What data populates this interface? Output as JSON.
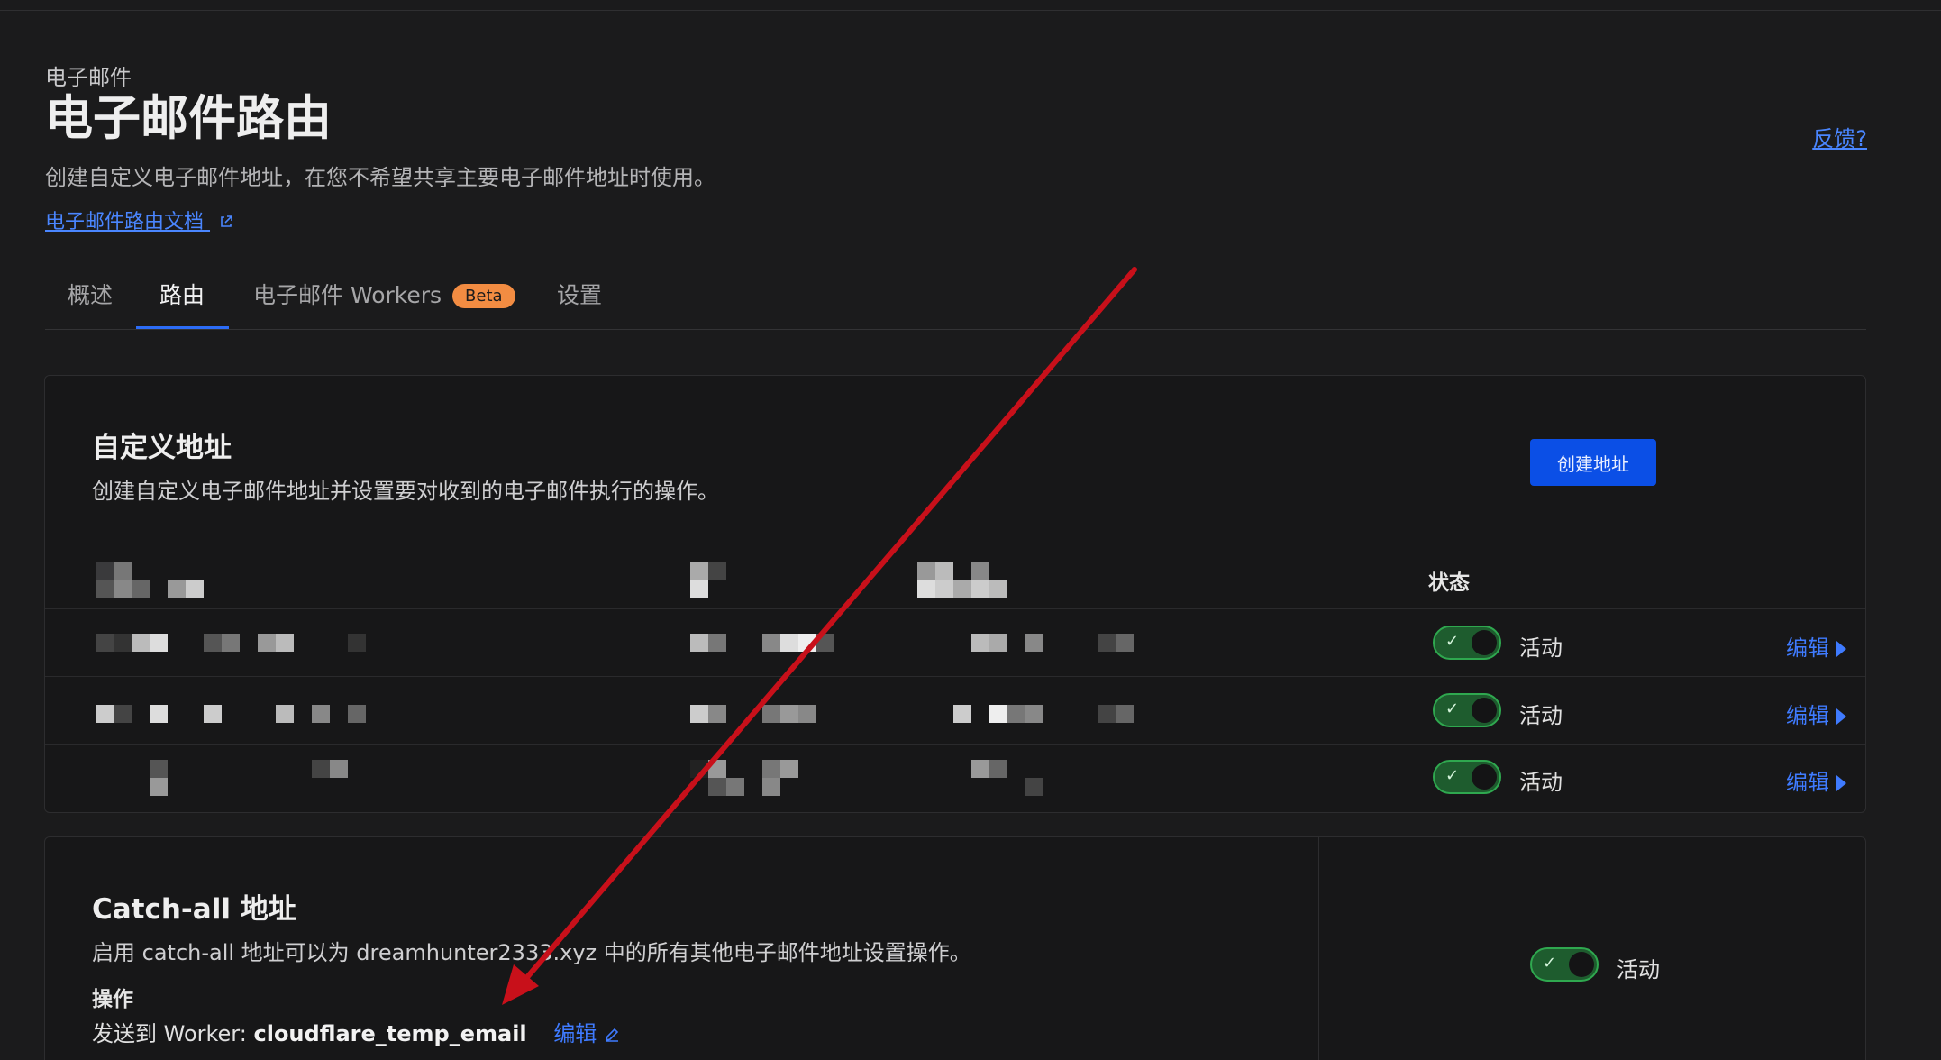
{
  "header": {
    "section_label": "电子邮件",
    "title": "电子邮件路由",
    "description": "创建自定义电子邮件地址，在您不希望共享主要电子邮件地址时使用。",
    "docs_link": "电子邮件路由文档",
    "feedback": "反馈?"
  },
  "tabs": [
    {
      "label": "概述"
    },
    {
      "label": "路由"
    },
    {
      "label": "电子邮件 Workers",
      "badge": "Beta"
    },
    {
      "label": "设置"
    }
  ],
  "custom_addresses": {
    "title": "自定义地址",
    "description": "创建自定义电子邮件地址并设置要对收到的电子邮件执行的操作。",
    "create_button": "创建地址",
    "status_header": "状态",
    "rows": [
      {
        "status": "活动",
        "edit": "编辑"
      },
      {
        "status": "活动",
        "edit": "编辑"
      },
      {
        "status": "活动",
        "edit": "编辑"
      }
    ]
  },
  "catch_all": {
    "title": "Catch-all 地址",
    "description": "启用 catch-all 地址可以为 dreamhunter2333.xyz 中的所有其他电子邮件地址设置操作。",
    "action_label": "操作",
    "action_prefix": "发送到 Worker: ",
    "worker_name": "cloudflare_temp_email",
    "edit": "编辑",
    "status": "活动"
  },
  "colors": {
    "background": "#1b1b1c",
    "card": "#171718",
    "accent_link": "#3f7bff",
    "primary_button": "#0b4fe6",
    "toggle_on": "#2fa84f",
    "badge": "#f28c42",
    "annotation_arrow": "#c8101a"
  },
  "icons": [
    "external-link-icon",
    "check-icon",
    "chevron-right-icon",
    "pencil-icon",
    "annotation-arrow"
  ]
}
